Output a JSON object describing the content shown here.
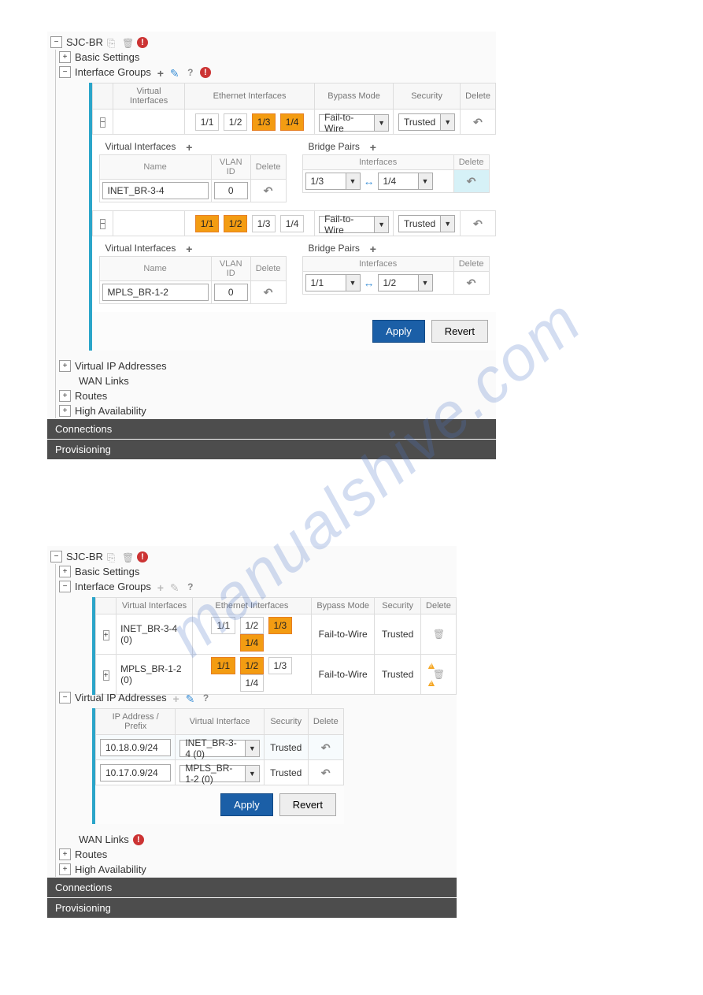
{
  "watermark": "manualshive.com",
  "panel1": {
    "title": "SJC-BR",
    "nodes": {
      "basic": "Basic Settings",
      "ig": "Interface Groups",
      "vip": "Virtual IP Addresses",
      "wan": "WAN Links",
      "routes": "Routes",
      "ha": "High Availability"
    },
    "ig_headers": {
      "vi": "Virtual Interfaces",
      "ei": "Ethernet Interfaces",
      "bm": "Bypass Mode",
      "sec": "Security",
      "del": "Delete"
    },
    "eth": {
      "p1": "1/1",
      "p2": "1/2",
      "p3": "1/3",
      "p4": "1/4"
    },
    "bypass": "Fail-to-Wire",
    "security": "Trusted",
    "sub": {
      "vi": "Virtual Interfaces",
      "bp": "Bridge Pairs"
    },
    "vi_headers": {
      "name": "Name",
      "vlan": "VLAN ID",
      "del": "Delete"
    },
    "bp_headers": {
      "if": "Interfaces",
      "del": "Delete"
    },
    "group1": {
      "name": "INET_BR-3-4",
      "vlan": "0",
      "bpa": "1/3",
      "bpb": "1/4"
    },
    "group2": {
      "name": "MPLS_BR-1-2",
      "vlan": "0",
      "bpa": "1/1",
      "bpb": "1/2"
    },
    "buttons": {
      "apply": "Apply",
      "revert": "Revert"
    },
    "bars": {
      "conn": "Connections",
      "prov": "Provisioning"
    }
  },
  "panel2": {
    "title": "SJC-BR",
    "nodes": {
      "basic": "Basic Settings",
      "ig": "Interface Groups",
      "vip": "Virtual IP Addresses",
      "wan": "WAN Links",
      "routes": "Routes",
      "ha": "High Availability"
    },
    "ig_headers": {
      "vi": "Virtual Interfaces",
      "ei": "Ethernet Interfaces",
      "bm": "Bypass Mode",
      "sec": "Security",
      "del": "Delete"
    },
    "row1": {
      "name": "INET_BR-3-4 (0)",
      "bm": "Fail-to-Wire",
      "sec": "Trusted"
    },
    "row2": {
      "name": "MPLS_BR-1-2 (0)",
      "bm": "Fail-to-Wire",
      "sec": "Trusted"
    },
    "eth": {
      "p1": "1/1",
      "p2": "1/2",
      "p3": "1/3",
      "p4": "1/4"
    },
    "vip_headers": {
      "ip": "IP Address / Prefix",
      "vi": "Virtual Interface",
      "sec": "Security",
      "del": "Delete"
    },
    "vip_row1": {
      "ip": "10.18.0.9/24",
      "vi": "INET_BR-3-4 (0)",
      "sec": "Trusted"
    },
    "vip_row2": {
      "ip": "10.17.0.9/24",
      "vi": "MPLS_BR-1-2 (0)",
      "sec": "Trusted"
    },
    "buttons": {
      "apply": "Apply",
      "revert": "Revert"
    },
    "bars": {
      "conn": "Connections",
      "prov": "Provisioning"
    }
  }
}
